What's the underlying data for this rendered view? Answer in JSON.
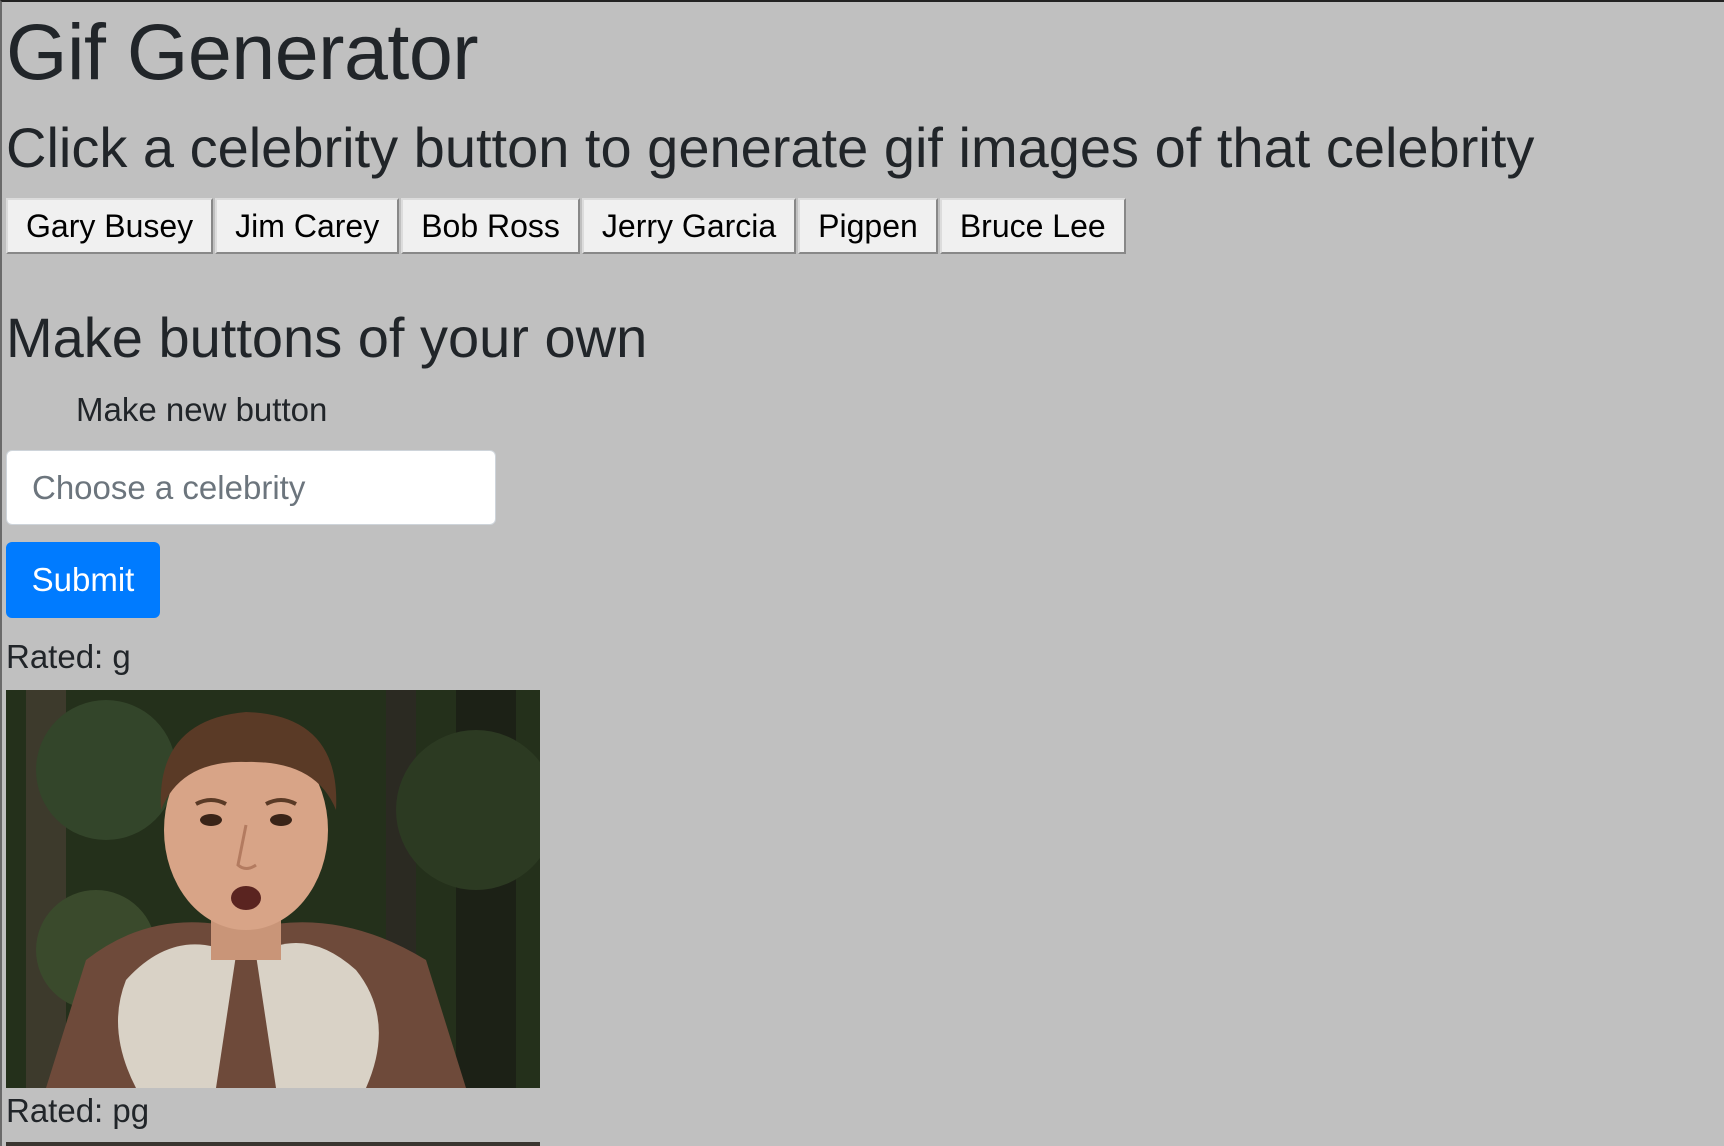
{
  "header": {
    "title": "Gif Generator",
    "subtitle": "Click a celebrity button to generate gif images of that celebrity"
  },
  "celebrity_buttons": [
    {
      "label": "Gary Busey"
    },
    {
      "label": "Jim Carey"
    },
    {
      "label": "Bob Ross"
    },
    {
      "label": "Jerry Garcia"
    },
    {
      "label": "Pigpen"
    },
    {
      "label": "Bruce Lee"
    }
  ],
  "form": {
    "heading": "Make buttons of your own",
    "label": "Make new button",
    "input_value": "",
    "input_placeholder": "Choose a celebrity",
    "submit_label": "Submit"
  },
  "results": [
    {
      "rating_label": "Rated: g"
    },
    {
      "rating_label": "Rated: pg"
    }
  ],
  "colors": {
    "background": "#c0c0c0",
    "primary_button": "#007bff",
    "text": "#212529"
  }
}
